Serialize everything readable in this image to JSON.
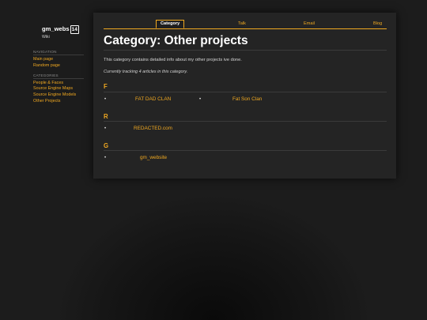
{
  "logo": {
    "name": "gm_webs",
    "badge": "14",
    "subtitle": "Wiki"
  },
  "sidebar": {
    "navigation": {
      "heading": "NAVIGATION",
      "items": [
        {
          "label": "Main page"
        },
        {
          "label": "Random page"
        }
      ]
    },
    "categories": {
      "heading": "CATEGORIES",
      "items": [
        {
          "label": "People & Faces"
        },
        {
          "label": "Source Engine Maps"
        },
        {
          "label": "Source Engine Models"
        },
        {
          "label": "Other Projects"
        }
      ]
    }
  },
  "tabs": [
    {
      "label": "Category",
      "active": true
    },
    {
      "label": "Talk"
    },
    {
      "label": "Email"
    },
    {
      "label": "Blog"
    }
  ],
  "page": {
    "title": "Category: Other projects",
    "intro": "This category contains detailed info about my other projects ive done.",
    "tracking": "Currently tracking 4 articles in this category."
  },
  "groups": [
    {
      "letter": "F",
      "articles": [
        {
          "label": "FAT DAD CLAN"
        },
        {
          "label": "Fat Son Clan"
        }
      ]
    },
    {
      "letter": "R",
      "articles": [
        {
          "label": "REDACTED.com"
        }
      ]
    },
    {
      "letter": "G",
      "articles": [
        {
          "label": "gm_website"
        }
      ]
    }
  ],
  "colors": {
    "accent": "#f0a820",
    "background": "#1d1d1d",
    "panel": "#242424"
  }
}
